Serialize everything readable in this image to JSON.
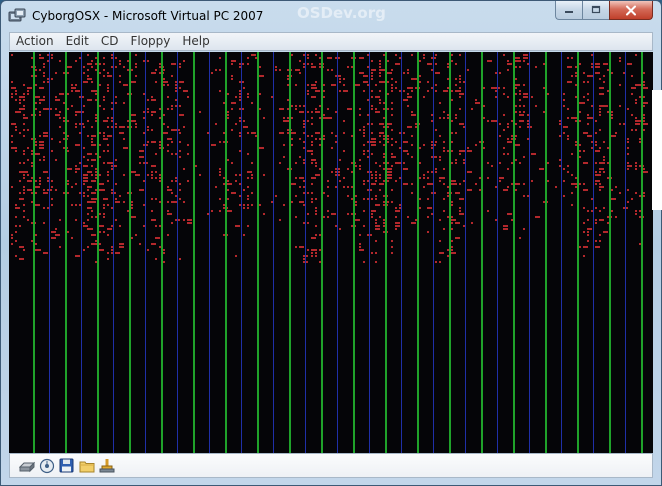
{
  "window": {
    "title": "CyborgOSX - Microsoft Virtual PC 2007",
    "background_title": "OSDev.org",
    "app_icon": "virtual-pc-icon"
  },
  "caption_buttons": [
    {
      "name": "minimize",
      "icon": "minimize-icon"
    },
    {
      "name": "maximize",
      "icon": "maximize-icon"
    },
    {
      "name": "close",
      "icon": "close-icon"
    }
  ],
  "menu": {
    "items": [
      "Action",
      "Edit",
      "CD",
      "Floppy",
      "Help"
    ]
  },
  "screen": {
    "background": "#050508",
    "garbage_color": "#b3282c",
    "line_colors": [
      "#1fa22a",
      "#1f2fa8"
    ]
  },
  "status_icons": [
    {
      "name": "hard-disk-icon"
    },
    {
      "name": "cd-icon"
    },
    {
      "name": "floppy-icon"
    },
    {
      "name": "shared-folder-icon"
    },
    {
      "name": "network-icon"
    }
  ]
}
